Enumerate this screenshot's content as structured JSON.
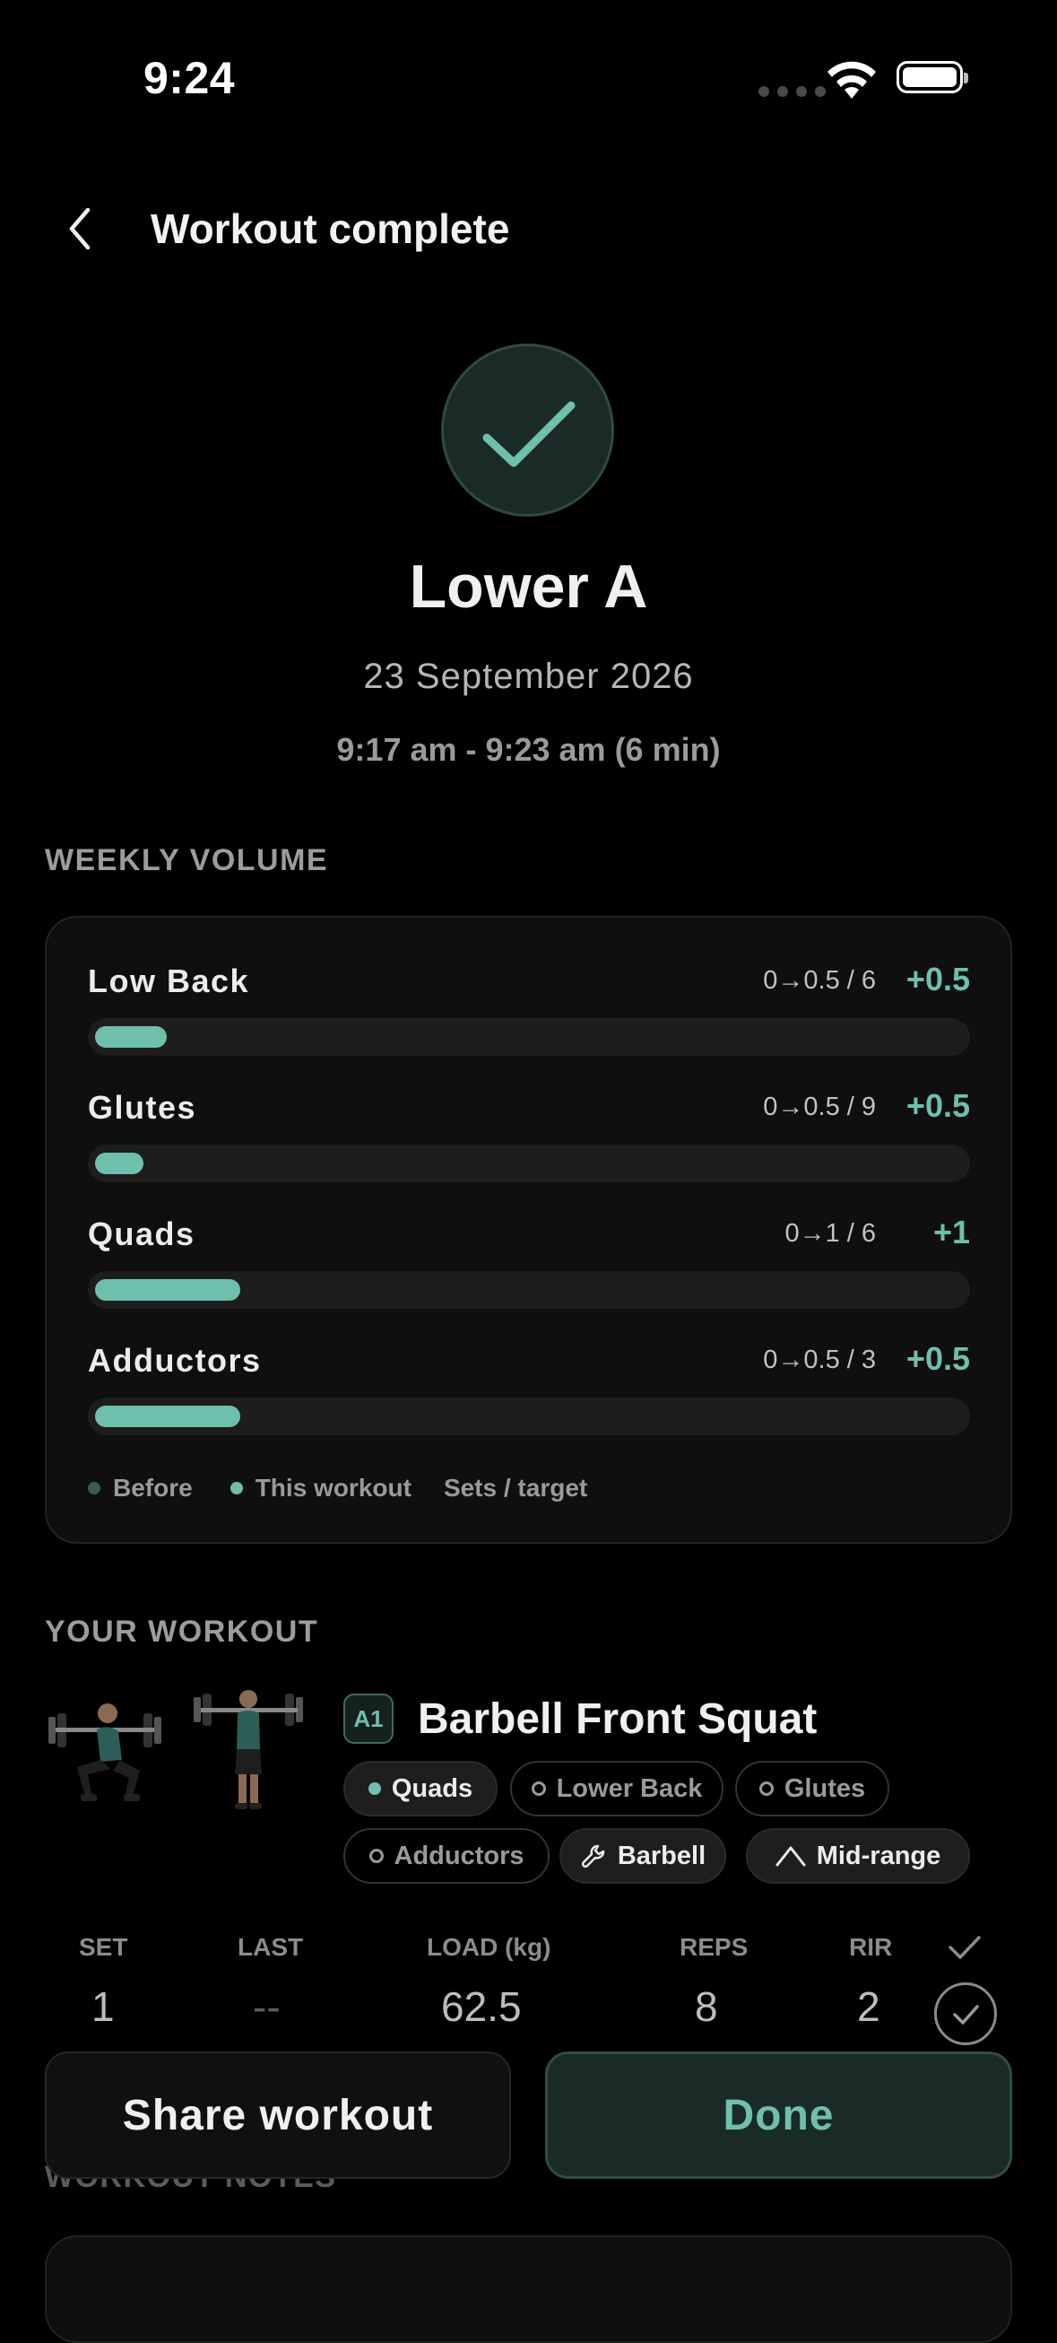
{
  "status_bar": {
    "time": "9:24"
  },
  "header": {
    "title": "Workout complete",
    "back_icon": "chevron-left-icon"
  },
  "summary": {
    "workout_name": "Lower A",
    "date": "23 September 2026",
    "time_range": "9:17 am - 9:23 am (6 min)",
    "icon": "checkmark-icon"
  },
  "weekly_volume": {
    "label": "WEEKLY VOLUME",
    "rows": [
      {
        "name": "Low Back",
        "ratio": "0→0.5 / 6",
        "delta": "+0.5",
        "progress": 0.083
      },
      {
        "name": "Glutes",
        "ratio": "0→0.5 / 9",
        "delta": "+0.5",
        "progress": 0.056
      },
      {
        "name": "Quads",
        "ratio": "0→1 / 6",
        "delta": "+1",
        "progress": 0.167
      },
      {
        "name": "Adductors",
        "ratio": "0→0.5 / 3",
        "delta": "+0.5",
        "progress": 0.167
      }
    ],
    "legend": {
      "before": "Before",
      "this_workout": "This workout",
      "sets_target": "Sets / target"
    }
  },
  "your_workout": {
    "label": "YOUR WORKOUT",
    "exercise": {
      "badge": "A1",
      "name": "Barbell Front Squat",
      "tags": [
        {
          "label": "Quads",
          "style": "primary"
        },
        {
          "label": "Lower Back",
          "style": "secondary"
        },
        {
          "label": "Glutes",
          "style": "secondary"
        },
        {
          "label": "Adductors",
          "style": "secondary"
        },
        {
          "label": "Barbell",
          "style": "equipment",
          "icon": "wrench-icon"
        },
        {
          "label": "Mid-range",
          "style": "equipment",
          "icon": "curve-icon"
        }
      ]
    },
    "set_table": {
      "headers": {
        "set": "SET",
        "last": "LAST",
        "load": "LOAD (kg)",
        "reps": "REPS",
        "rir": "RIR"
      },
      "rows": [
        {
          "set": "1",
          "last": "--",
          "load": "62.5",
          "reps": "8",
          "rir": "2"
        }
      ]
    }
  },
  "actions": {
    "share": "Share workout",
    "done": "Done"
  },
  "notes": {
    "label": "WORKOUT NOTES"
  },
  "colors": {
    "accent": "#6fbfad",
    "background": "#000000",
    "card": "#0f0f0f"
  }
}
